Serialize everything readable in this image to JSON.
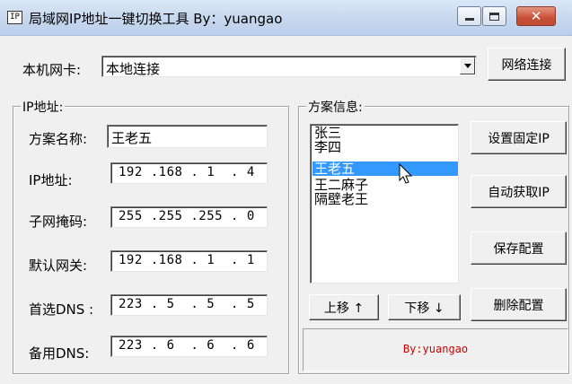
{
  "window": {
    "icon_glyph": "IP",
    "title": "局域网IP地址一键切换工具  By：yuangao",
    "close_glyph": "✕"
  },
  "adapter": {
    "label": "本机网卡:",
    "selected": "本地连接",
    "connect_button": "网络连接"
  },
  "ip_group": {
    "title": "IP地址:",
    "fields": [
      {
        "label": "方案名称:",
        "value": "王老五"
      },
      {
        "label": "IP地址:",
        "value": "192 .168 . 1  . 4"
      },
      {
        "label": "子网掩码:",
        "value": "255 .255 .255 . 0"
      },
      {
        "label": "默认网关:",
        "value": "192 .168 . 1  . 1"
      },
      {
        "label": "首选DNS :",
        "value": "223 . 5  . 5  . 5"
      },
      {
        "label": "备用DNS:",
        "value": "223 . 6  . 6  . 6"
      }
    ]
  },
  "scheme_group": {
    "title": "方案信息:",
    "items": [
      "张三",
      "李四",
      "王老五",
      "王二麻子",
      "隔壁老王"
    ],
    "selected_index": 2,
    "buttons": {
      "set_fixed_ip": "设置固定IP",
      "auto_ip": "自动获取IP",
      "save_config": "保存配置",
      "move_up": "上移 ↑",
      "move_down": "下移 ↓",
      "delete_config": "删除配置"
    }
  },
  "signature": {
    "text": "By:yuangao",
    "color": "#cc0000"
  },
  "colors": {
    "selection": "#3399ff",
    "close_button": "#c75038"
  }
}
